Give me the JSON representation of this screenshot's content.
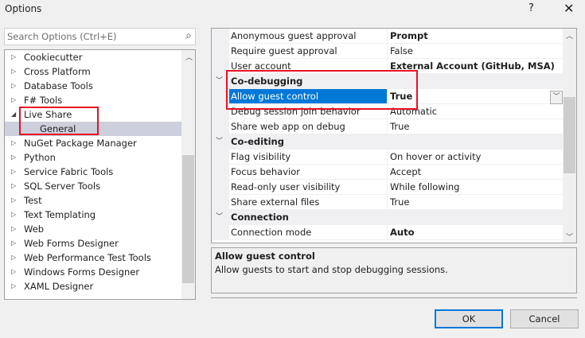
{
  "window": {
    "title": "Options",
    "help": "?",
    "close": "✕"
  },
  "search": {
    "placeholder": "Search Options (Ctrl+E)"
  },
  "tree": [
    {
      "label": "Cookiecutter",
      "expander": "▷"
    },
    {
      "label": "Cross Platform",
      "expander": "▷"
    },
    {
      "label": "Database Tools",
      "expander": "▷"
    },
    {
      "label": "F# Tools",
      "expander": "▷"
    },
    {
      "label": "Live Share",
      "expander": "◢"
    },
    {
      "label": "General",
      "child": true,
      "selected": true
    },
    {
      "label": "NuGet Package Manager",
      "expander": "▷"
    },
    {
      "label": "Python",
      "expander": "▷"
    },
    {
      "label": "Service Fabric Tools",
      "expander": "▷"
    },
    {
      "label": "SQL Server Tools",
      "expander": "▷"
    },
    {
      "label": "Test",
      "expander": "▷"
    },
    {
      "label": "Text Templating",
      "expander": "▷"
    },
    {
      "label": "Web",
      "expander": "▷"
    },
    {
      "label": "Web Forms Designer",
      "expander": "▷"
    },
    {
      "label": "Web Performance Test Tools",
      "expander": "▷"
    },
    {
      "label": "Windows Forms Designer",
      "expander": "▷"
    },
    {
      "label": "XAML Designer",
      "expander": "▷"
    }
  ],
  "grid": [
    {
      "name": "Anonymous guest approval",
      "value": "Prompt",
      "bold": true
    },
    {
      "name": "Require guest approval",
      "value": "False"
    },
    {
      "name": "User account",
      "value": "External Account (GitHub, MSA)",
      "bold": true
    },
    {
      "category": "Co-debugging"
    },
    {
      "name": "Allow guest control",
      "value": "True",
      "bold": true,
      "selected": true
    },
    {
      "name": "Debug session join behavior",
      "value": "Automatic"
    },
    {
      "name": "Share web app on debug",
      "value": "True"
    },
    {
      "category": "Co-editing"
    },
    {
      "name": "Flag visibility",
      "value": "On hover or activity"
    },
    {
      "name": "Focus behavior",
      "value": "Accept"
    },
    {
      "name": "Read-only user visibility",
      "value": "While following"
    },
    {
      "name": "Share external files",
      "value": "True"
    },
    {
      "category": "Connection"
    },
    {
      "name": "Connection mode",
      "value": "Auto",
      "bold": true
    }
  ],
  "description": {
    "title": "Allow guest control",
    "text": "Allow guests to start and stop debugging sessions."
  },
  "buttons": {
    "ok": "OK",
    "cancel": "Cancel"
  },
  "colors": {
    "selection": "#0078d7",
    "highlight": "#e81123"
  }
}
